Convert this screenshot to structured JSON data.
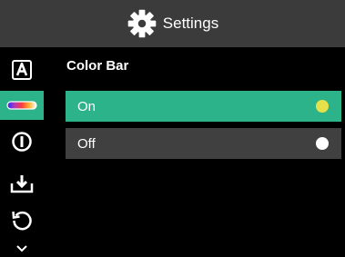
{
  "header": {
    "title": "Settings",
    "icon": "gear-icon"
  },
  "sidebar": {
    "items": [
      {
        "icon": "text-a-icon",
        "active": false
      },
      {
        "icon": "color-bar-icon",
        "active": true
      },
      {
        "icon": "info-circle-icon",
        "active": false
      },
      {
        "icon": "download-icon",
        "active": false
      },
      {
        "icon": "reset-icon",
        "active": false
      },
      {
        "icon": "chevron-down-icon",
        "active": false
      }
    ]
  },
  "main": {
    "section_title": "Color Bar",
    "options": [
      {
        "label": "On",
        "selected": true,
        "dot_color": "#e6e04a"
      },
      {
        "label": "Off",
        "selected": false,
        "dot_color": "#ffffff"
      }
    ]
  },
  "colors": {
    "accent": "#2db38a",
    "header_bg": "#3b3b3b",
    "option_bg": "#404040"
  }
}
